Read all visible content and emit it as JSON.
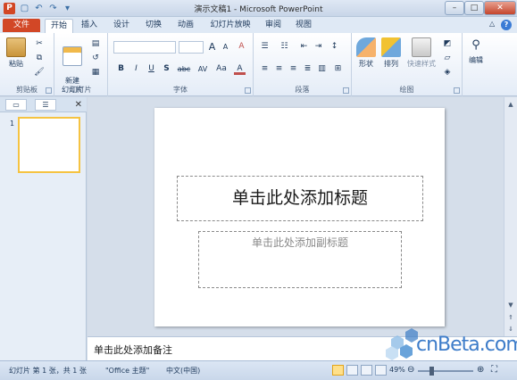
{
  "window": {
    "title": "演示文稿1 - Microsoft PowerPoint",
    "minimize": "–",
    "maximize": "□",
    "close": "✕"
  },
  "qat": {
    "app_letter": "P",
    "save": "💾",
    "undo": "↶",
    "redo": "↷",
    "customize": "▾"
  },
  "tabs": {
    "file": "文件",
    "items": [
      "开始",
      "插入",
      "设计",
      "切换",
      "动画",
      "幻灯片放映",
      "审阅",
      "视图"
    ],
    "active": "开始",
    "help": "?",
    "minimize_ribbon": "△"
  },
  "ribbon": {
    "clipboard": {
      "label": "剪贴板",
      "paste": "粘贴"
    },
    "slides": {
      "label": "幻灯片",
      "new_slide": "新建\n幻灯片"
    },
    "font": {
      "label": "字体",
      "bold": "B",
      "italic": "I",
      "underline": "U",
      "strike": "S",
      "shadow": "abc",
      "spacing": "AV",
      "case": "Aa",
      "grow": "A",
      "shrink": "A",
      "clear": "A",
      "color": "A"
    },
    "paragraph": {
      "label": "段落"
    },
    "drawing": {
      "label": "绘图",
      "shapes": "形状",
      "arrange": "排列",
      "quick_styles": "快速样式"
    },
    "editing": {
      "label": "编辑"
    }
  },
  "slide_pane": {
    "tab_slides": "▭",
    "tab_outline": "☰",
    "close": "✕",
    "thumb_number": "1"
  },
  "slide": {
    "title_placeholder": "单击此处添加标题",
    "subtitle_placeholder": "单击此处添加副标题"
  },
  "notes": {
    "placeholder": "单击此处添加备注"
  },
  "watermark": {
    "text": "cnBeta.com"
  },
  "status": {
    "slide_info": "幻灯片 第 1 张，共 1 张",
    "theme": "\"Office 主题\"",
    "language": "中文(中国)",
    "zoom": "49%",
    "zoom_level": 0.49
  },
  "colors": {
    "file_tab": "#d24726",
    "accent": "#1e395b",
    "active_view": "#ffe08a"
  }
}
